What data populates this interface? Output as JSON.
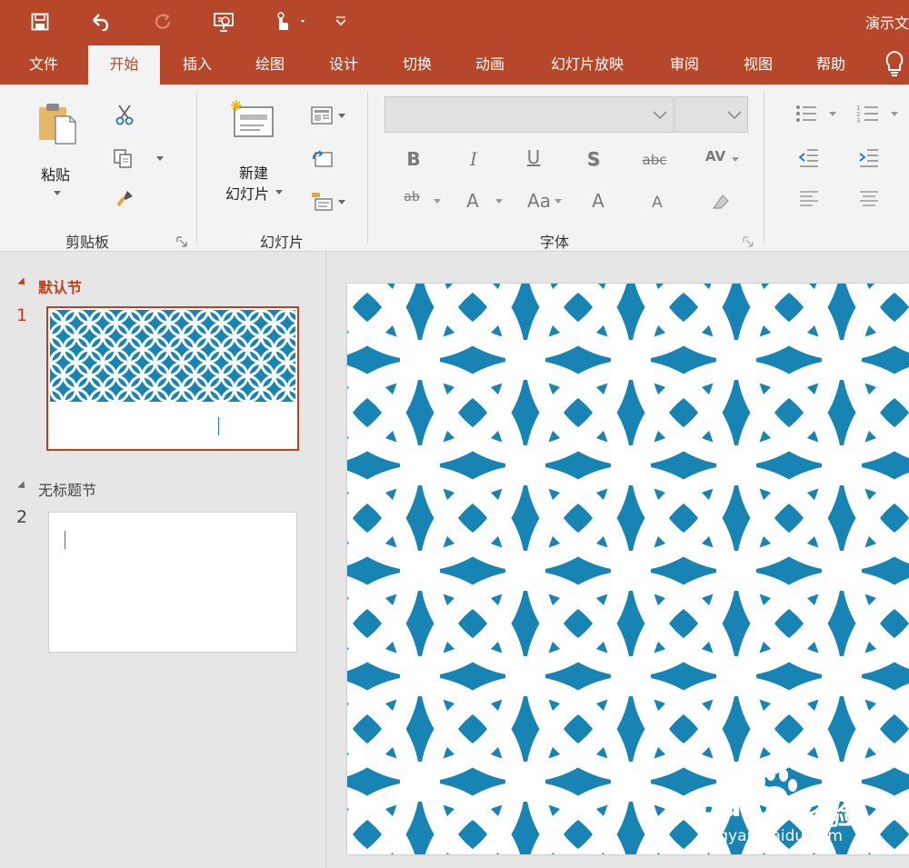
{
  "app": {
    "doc_title": "演示文",
    "accent_color": "#b7472a"
  },
  "quick_access": {
    "icons": [
      "save-icon",
      "undo-icon",
      "redo-icon",
      "present-from-start-icon",
      "touch-mouse-mode-icon",
      "customize-toolbar-icon"
    ]
  },
  "tabs": [
    {
      "label": "文件"
    },
    {
      "label": "开始"
    },
    {
      "label": "插入"
    },
    {
      "label": "绘图"
    },
    {
      "label": "设计"
    },
    {
      "label": "切换"
    },
    {
      "label": "动画"
    },
    {
      "label": "幻灯片放映"
    },
    {
      "label": "审阅"
    },
    {
      "label": "视图"
    },
    {
      "label": "帮助"
    }
  ],
  "active_tab": "开始",
  "ribbon": {
    "clipboard": {
      "label": "剪贴板",
      "paste_label": "粘贴"
    },
    "slides": {
      "label": "幻灯片",
      "new_slide_line1": "新建",
      "new_slide_line2": "幻灯片"
    },
    "font": {
      "label": "字体",
      "font_name_value": "",
      "font_size_value": "",
      "bold_glyph": "B",
      "italic_glyph": "I",
      "underline_glyph": "U",
      "shadow_glyph": "S",
      "strike_glyph": "abc",
      "spacing_glyph": "AV",
      "highlight_glyph": "ab",
      "font_color_glyph": "A",
      "change_case_glyph": "Aa",
      "grow_glyph": "A",
      "shrink_glyph": "A"
    }
  },
  "sections": [
    {
      "name": "默认节",
      "color": "#c43e1c",
      "slides": [
        {
          "number": "1",
          "selected": true
        }
      ]
    },
    {
      "name": "无标题节",
      "color": "#555555",
      "slides": [
        {
          "number": "2",
          "selected": false
        }
      ]
    }
  ],
  "slide_pattern": {
    "background": "#1784b3",
    "ring_color": "#ffffff"
  },
  "watermark": {
    "brand": "Baidu",
    "cn_text": "经验",
    "url": "jingyan.baidu.com"
  }
}
